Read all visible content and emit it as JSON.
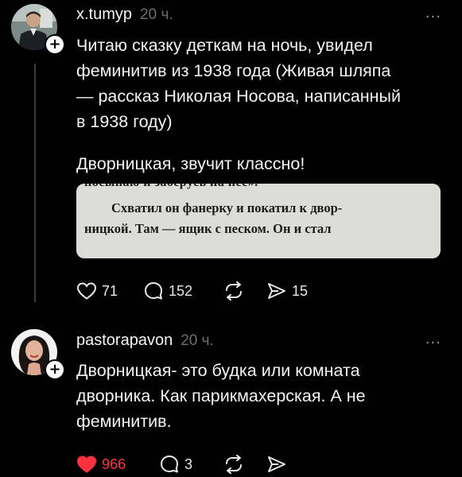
{
  "post1": {
    "username": "x.tumyp",
    "time": "20 ч.",
    "more": "...",
    "plus": "+",
    "text_lines": [
      "Читаю сказку деткам на ночь, увидел",
      "феминитив из 1938 года (Живая шляпа",
      "— рассказ Николая Носова, написанный",
      "в 1938 году)"
    ],
    "text2": "Дворницкая, звучит классно!",
    "book_image": {
      "cut_line": "посынаю и заберусь на нее».",
      "line1": "Схватил он фанерку и покатил к двор-",
      "line2": "ницкой. Там — ящик с песком. Он и стал"
    },
    "actions": {
      "likes": "71",
      "comments": "152",
      "shares": "15"
    },
    "icons": [
      "heart-icon",
      "comment-icon",
      "repost-icon",
      "share-icon"
    ]
  },
  "post2": {
    "username": "pastorapavon",
    "time": "20 ч.",
    "more": "...",
    "plus": "+",
    "text_lines": [
      "Дворницкая- это будка или комната",
      "дворника. Как парикмахерская. А не",
      "феминитив."
    ],
    "actions": {
      "likes": "966",
      "comments": "3"
    },
    "liked_color": "#ff3040"
  }
}
